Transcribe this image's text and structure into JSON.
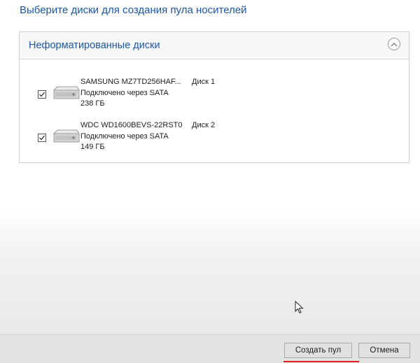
{
  "page": {
    "title": "Выберите диски для создания пула носителей"
  },
  "panel": {
    "title": "Неформатированные диски",
    "collapse_icon": "chevron-up-icon",
    "disks": [
      {
        "checked": true,
        "icon": "hard-drive-icon",
        "name": "SAMSUNG MZ7TD256HAF...",
        "connection": "Подключено через SATA",
        "size": "238 ГБ",
        "label": "Диск 1"
      },
      {
        "checked": true,
        "icon": "hard-drive-icon",
        "name": "WDC WD1600BEVS-22RST0",
        "connection": "Подключено через SATA",
        "size": "149 ГБ",
        "label": "Диск 2"
      }
    ]
  },
  "footer": {
    "create_label": "Создать пул",
    "cancel_label": "Отмена"
  },
  "colors": {
    "accent_text": "#1a56a8",
    "highlight_underline": "#e02020"
  }
}
